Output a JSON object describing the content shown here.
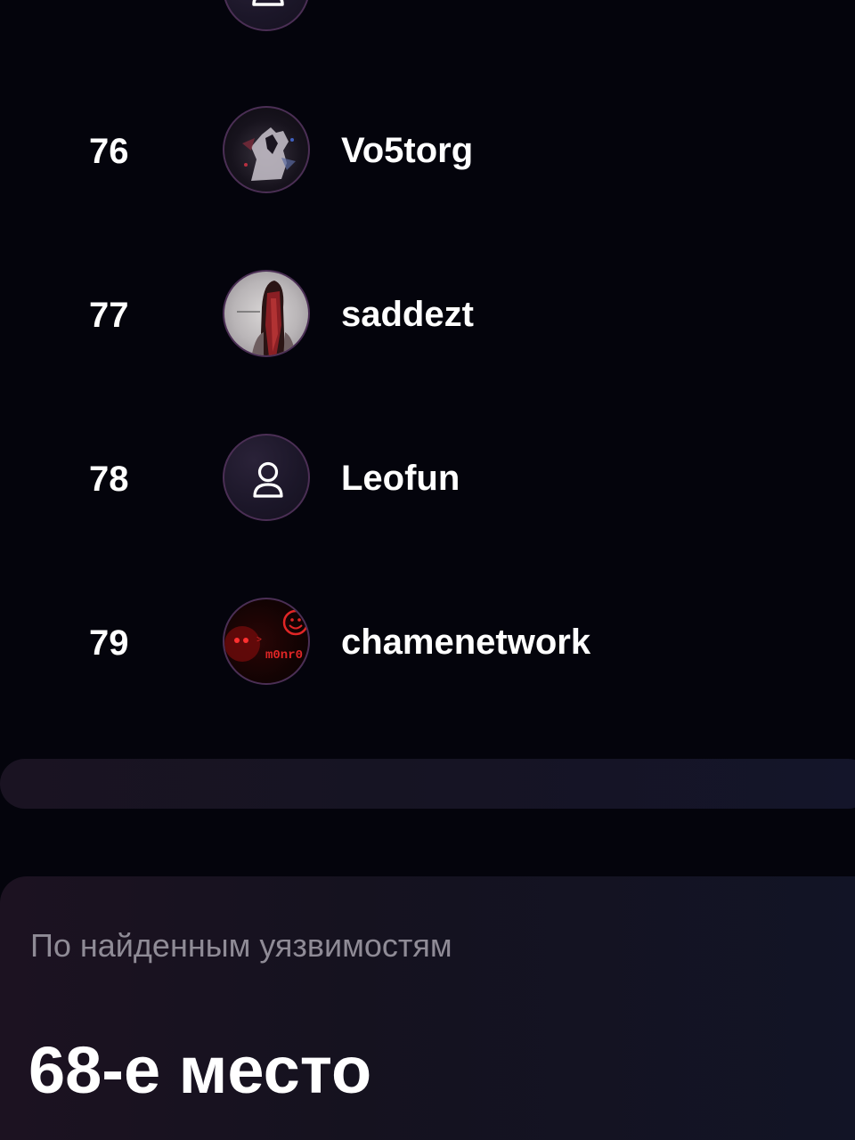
{
  "leaderboard": {
    "rows": [
      {
        "rank": "",
        "username": "",
        "avatar": "user-icon"
      },
      {
        "rank": "76",
        "username": "Vo5torg",
        "avatar": "horse-image"
      },
      {
        "rank": "77",
        "username": "saddezt",
        "avatar": "masked-figure-image"
      },
      {
        "rank": "78",
        "username": "Leofun",
        "avatar": "user-icon"
      },
      {
        "rank": "79",
        "username": "chamenetwork",
        "avatar": "m0nr0-logo-image",
        "avatar_text": "m0nr0"
      }
    ]
  },
  "summary_card": {
    "caption": "По найденным уязвимостям",
    "value": "68-е место"
  },
  "colors": {
    "background": "#04040c",
    "avatar_ring": "#4b2f55",
    "caption": "#8f8b96",
    "text": "#ffffff"
  }
}
